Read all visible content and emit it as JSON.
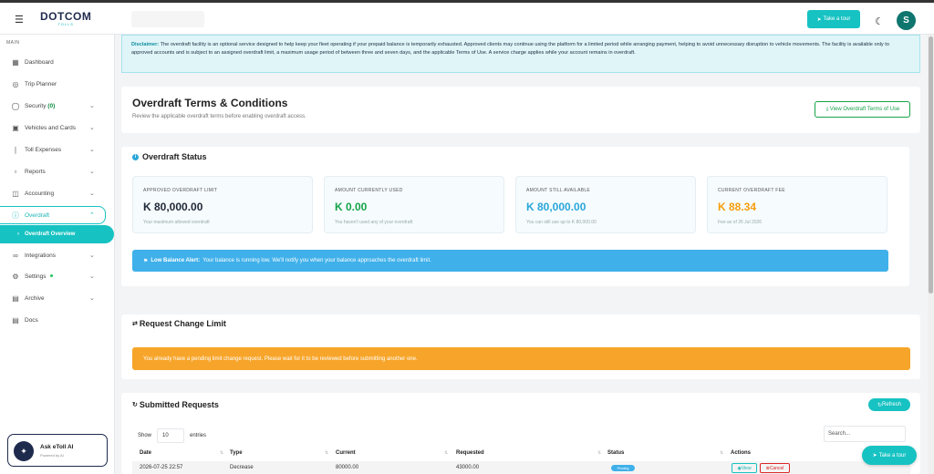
{
  "header": {
    "brand": "DOTCOM",
    "brand_tagline": "TOLLS",
    "tour_button": "Take a tour",
    "avatar_initial": "S"
  },
  "sidebar": {
    "section_label": "MAIN",
    "items": [
      {
        "label": "Dashboard",
        "icon": "grid-icon"
      },
      {
        "label": "Trip Planner",
        "icon": "map-pin-icon"
      },
      {
        "label": "Security",
        "badge": "(0)",
        "icon": "shield-icon"
      },
      {
        "label": "Vehicles and Cards",
        "icon": "car-icon"
      },
      {
        "label": "Toll Expenses",
        "icon": "bar-chart-icon"
      },
      {
        "label": "Reports",
        "icon": "clipboard-icon"
      },
      {
        "label": "Accounting",
        "icon": "book-icon"
      },
      {
        "label": "Overdraft",
        "icon": "info-circle-icon"
      },
      {
        "label": "Integrations",
        "icon": "link-icon"
      },
      {
        "label": "Settings",
        "icon": "gear-icon"
      },
      {
        "label": "Archive",
        "icon": "archive-icon"
      },
      {
        "label": "Docs",
        "icon": "document-icon"
      }
    ],
    "sub_item": "Overdraft Overview",
    "ask": {
      "title": "Ask eToll AI",
      "subtitle": "Powered by AI"
    }
  },
  "disclaimer": {
    "label": "Disclaimer:",
    "text": "The overdraft facility is an optional service designed to help keep your fleet operating if your prepaid balance is temporarily exhausted. Approved clients may continue using the platform for a limited period while arranging payment, helping to avoid unnecessary disruption to vehicle movements. The facility is available only to approved accounts and is subject to an assigned overdraft limit, a maximum usage period of between three and seven days, and the applicable Terms of Use. A service charge applies while your account remains in overdraft."
  },
  "terms": {
    "title": "Overdraft Terms & Conditions",
    "subtitle": "Review the applicable overdraft terms before enabling overdraft access.",
    "button": "View Overdraft Terms of Use"
  },
  "status": {
    "title": "Overdraft Status",
    "cards": [
      {
        "label": "APPROVED OVERDRAFT LIMIT",
        "value": "K 80,000.00",
        "hint": "Your maximum allowed overdraft",
        "color": "#1f2937"
      },
      {
        "label": "AMOUNT CURRENTLY USED",
        "value": "K 0.00",
        "hint": "You haven't used any of your overdraft",
        "color": "#16a34a"
      },
      {
        "label": "AMOUNT STILL AVAILABLE",
        "value": "K 80,000.00",
        "hint": "You can still use up to K 80,000.00",
        "color": "#2aa6d9"
      },
      {
        "label": "CURRENT OVERDRAFT FEE",
        "value": "K 88.34",
        "hint": "Fee as of 26 Jul 2026",
        "color": "#f59e0b"
      }
    ],
    "alert_label": "Low Balance Alert:",
    "alert_text": "Your balance is running low. We'll notify you when your balance approaches the overdraft limit."
  },
  "change_limit": {
    "title": "Request Change Limit",
    "notice": "You already have a pending limit change request. Please wait for it to be reviewed before submitting another one."
  },
  "requests": {
    "title": "Submitted Requests",
    "refresh": "Refresh",
    "show_label": "Show",
    "entries_value": "10",
    "entries_label": "entries",
    "search_placeholder": "Search...",
    "columns": [
      "Date",
      "Type",
      "Current",
      "Requested",
      "Status",
      "Actions"
    ],
    "rows": [
      {
        "date": "2026-07-25 22:57",
        "type": "Decrease",
        "current": "80000.00",
        "requested": "43000.00",
        "status": "Pending",
        "view": "View",
        "cancel": "Cancel"
      }
    ]
  },
  "float_tour": "Take a tour"
}
